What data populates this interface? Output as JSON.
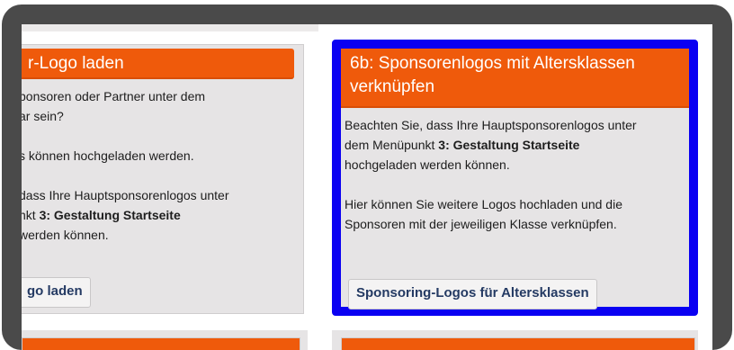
{
  "left_card": {
    "title": "r-Logo laden",
    "line1": "ponsoren oder Partner unter dem",
    "line2": "ar sein?",
    "line3": "s können hochgeladen werden.",
    "line4": "dass Ihre Hauptsponsorenlogos unter",
    "line5_pre": "nkt ",
    "line5_bold": "3: Gestaltung Startseite",
    "line6": "werden können.",
    "button": "go laden"
  },
  "right_card": {
    "title_line1": "6b: Sponsorenlogos mit Altersklassen",
    "title_line2": "verknüpfen",
    "para1_line1": "Beachten Sie, dass Ihre Hauptsponsorenlogos unter",
    "para1_line2_pre": "dem Menüpunkt ",
    "para1_line2_bold": "3: Gestaltung Startseite",
    "para1_line3": "hochgeladen werden können.",
    "para2_line1": "Hier können Sie weitere Logos hochladen und die",
    "para2_line2": "Sponsoren mit der jeweiligen Klasse verknüpfen.",
    "button": "Sponsoring-Logos für Altersklassen"
  },
  "colors": {
    "card_header": "#ef5a0b",
    "highlight_border": "#0a00f2",
    "card_background": "#e6e4e5",
    "frame": "#4a4a4a"
  }
}
